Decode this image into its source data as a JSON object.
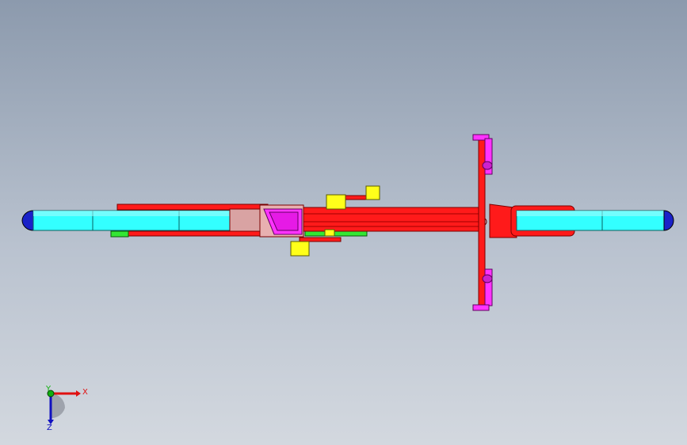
{
  "viewport": {
    "background_top": "#8c9aad",
    "background_bottom": "#d3d8df"
  },
  "model": {
    "colors": {
      "frame": "#ff1a1a",
      "frame_dark": "#b30000",
      "wheel": "#33ffff",
      "wheel_edge": "#0a8a8a",
      "tire_cap": "#1a22c8",
      "seat": "#ff33ff",
      "pedal": "#ffff1a",
      "chain_green": "#33e633",
      "handlebar": "#ff33ff"
    }
  },
  "triad": {
    "x_label": "X",
    "y_label": "Y",
    "z_label": "Z",
    "x_color": "#e01010",
    "y_color": "#10b010",
    "z_color": "#1010c0"
  }
}
